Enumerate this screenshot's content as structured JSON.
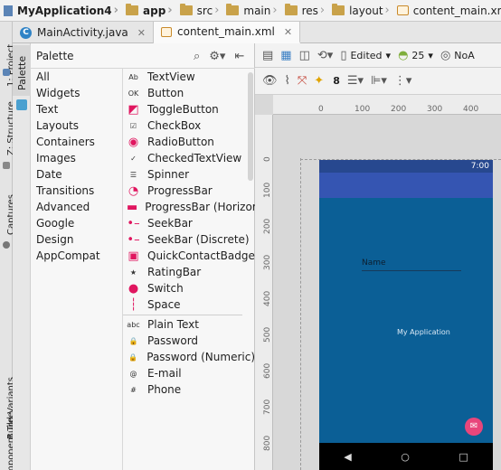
{
  "breadcrumbs": [
    {
      "label": "MyApplication4",
      "icon": "project-icon",
      "bold": true
    },
    {
      "label": "app",
      "icon": "folder-icon",
      "bold": true
    },
    {
      "label": "src",
      "icon": "folder-icon"
    },
    {
      "label": "main",
      "icon": "folder-icon"
    },
    {
      "label": "res",
      "icon": "res-folder-icon"
    },
    {
      "label": "layout",
      "icon": "folder-icon"
    },
    {
      "label": "content_main.xml",
      "icon": "xml-file-icon"
    }
  ],
  "tabs": [
    {
      "label": "MainActivity.java",
      "icon": "class-icon",
      "active": false
    },
    {
      "label": "content_main.xml",
      "icon": "xml-file-icon",
      "active": true
    }
  ],
  "side_tools": [
    "1: Project",
    "Z: Structure",
    "Captures",
    "Build Variants",
    "Component Tree"
  ],
  "palette": {
    "side_tab": "Palette",
    "title": "Palette",
    "categories": [
      "All",
      "Widgets",
      "Text",
      "Layouts",
      "Containers",
      "Images",
      "Date",
      "Transitions",
      "Advanced",
      "Google",
      "Design",
      "AppCompat"
    ],
    "widgets_group1": [
      {
        "label": "TextView",
        "glyph": "Ab"
      },
      {
        "label": "Button",
        "glyph": "OK"
      },
      {
        "label": "ToggleButton",
        "glyph": "◩"
      },
      {
        "label": "CheckBox",
        "glyph": "☑"
      },
      {
        "label": "RadioButton",
        "glyph": "◉"
      },
      {
        "label": "CheckedTextView",
        "glyph": "✓"
      },
      {
        "label": "Spinner",
        "glyph": "☰"
      },
      {
        "label": "ProgressBar",
        "glyph": "◔"
      },
      {
        "label": "ProgressBar (Horizor",
        "glyph": "▬"
      },
      {
        "label": "SeekBar",
        "glyph": "•–"
      },
      {
        "label": "SeekBar (Discrete)",
        "glyph": "•–"
      },
      {
        "label": "QuickContactBadge",
        "glyph": "▣"
      },
      {
        "label": "RatingBar",
        "glyph": "★"
      },
      {
        "label": "Switch",
        "glyph": "●"
      },
      {
        "label": "Space",
        "glyph": "┆"
      }
    ],
    "widgets_group2": [
      {
        "label": "Plain Text",
        "glyph": "abc"
      },
      {
        "label": "Password",
        "glyph": "🔒"
      },
      {
        "label": "Password (Numeric)",
        "glyph": "🔒"
      },
      {
        "label": "E-mail",
        "glyph": "@"
      },
      {
        "label": "Phone",
        "glyph": "#"
      }
    ]
  },
  "toolbar": {
    "edited_label": "Edited",
    "api_level": "25",
    "theme_label": "NoA",
    "margin_value": "8"
  },
  "ruler": {
    "h_ticks": [
      "0",
      "100",
      "200",
      "300",
      "400"
    ],
    "v_ticks": [
      "0",
      "100",
      "200",
      "300",
      "400",
      "500",
      "600",
      "700",
      "800"
    ]
  },
  "device": {
    "status_time": "7:00",
    "field_text": "Name",
    "center_text": "My Application",
    "nav_buttons": [
      "◀",
      "○",
      "□"
    ],
    "colors": {
      "content": "#0b5f96",
      "appbar": "#3555b2",
      "statusbar": "#27488f",
      "fab": "#e8467b"
    }
  }
}
